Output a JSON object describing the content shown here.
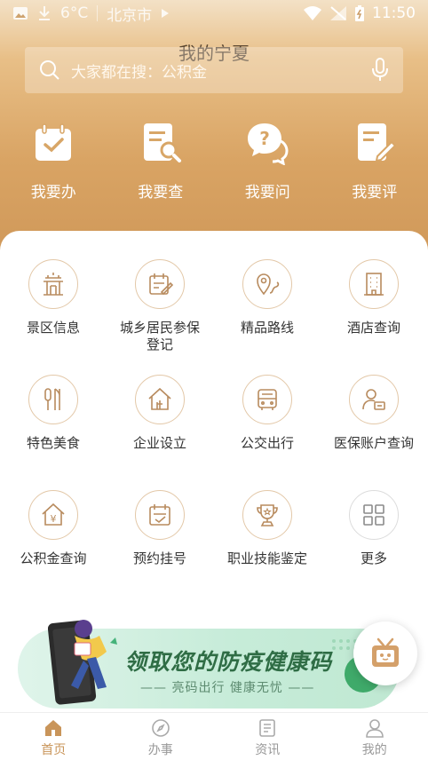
{
  "status_bar": {
    "temperature": "6°C",
    "location": "北京市",
    "time": "11:50"
  },
  "header": {
    "title": "我的宁夏"
  },
  "search": {
    "placeholder": "大家都在搜：公积金",
    "icon": "search-icon",
    "voice_icon": "microphone-icon"
  },
  "quick_actions": [
    {
      "label": "我要办",
      "icon": "calendar-check-icon"
    },
    {
      "label": "我要查",
      "icon": "document-search-icon"
    },
    {
      "label": "我要问",
      "icon": "question-chat-icon"
    },
    {
      "label": "我要评",
      "icon": "document-edit-icon"
    }
  ],
  "services": [
    {
      "label": "景区信息",
      "icon": "pavilion-icon"
    },
    {
      "label": "城乡居民参保登记",
      "icon": "register-icon"
    },
    {
      "label": "精品路线",
      "icon": "route-pin-icon"
    },
    {
      "label": "酒店查询",
      "icon": "hotel-building-icon"
    },
    {
      "label": "特色美食",
      "icon": "cutlery-icon"
    },
    {
      "label": "企业设立",
      "icon": "company-house-icon"
    },
    {
      "label": "公交出行",
      "icon": "bus-icon"
    },
    {
      "label": "医保账户查询",
      "icon": "medical-account-icon"
    },
    {
      "label": "公积金查询",
      "icon": "fund-house-icon"
    },
    {
      "label": "预约挂号",
      "icon": "appointment-icon"
    },
    {
      "label": "职业技能鉴定",
      "icon": "trophy-icon"
    },
    {
      "label": "更多",
      "icon": "more-grid-icon"
    }
  ],
  "banner": {
    "title": "领取您的防疫健康码",
    "subtitle": "—— 亮码出行 健康无忧 ——"
  },
  "tabbar": [
    {
      "label": "首页",
      "icon": "home-icon",
      "active": true
    },
    {
      "label": "办事",
      "icon": "compass-icon",
      "active": false
    },
    {
      "label": "资讯",
      "icon": "news-icon",
      "active": false
    },
    {
      "label": "我的",
      "icon": "user-icon",
      "active": false
    }
  ],
  "colors": {
    "accent": "#c9955a",
    "hero_top": "#f3e1c6",
    "hero_bottom": "#cf9758",
    "icon_stroke": "#b88b5e"
  }
}
